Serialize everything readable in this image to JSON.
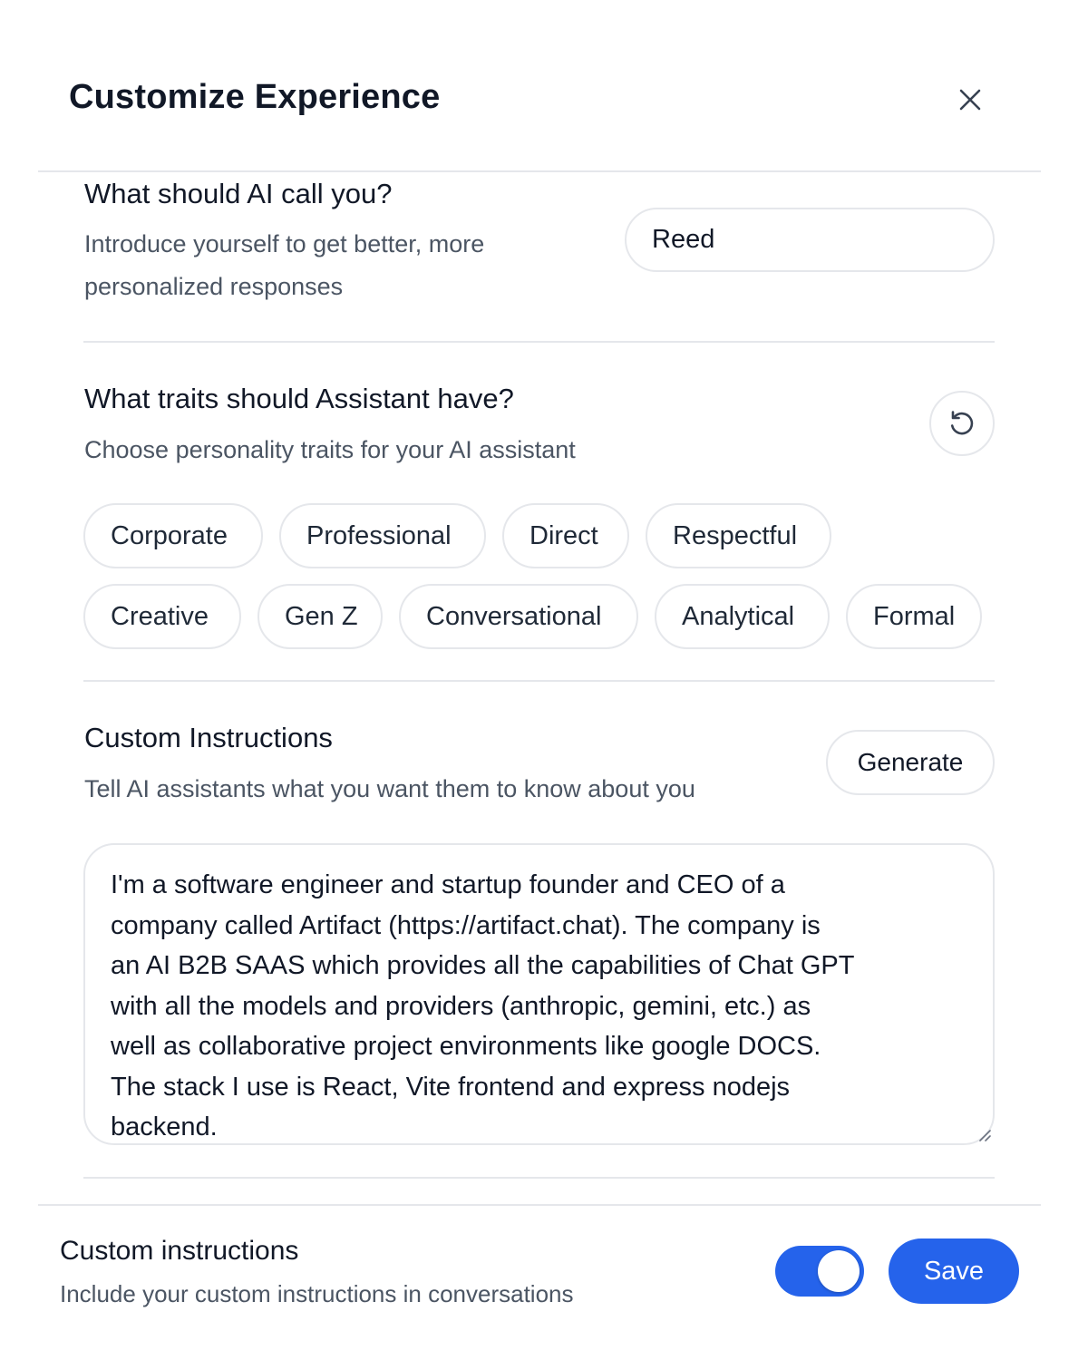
{
  "dialog": {
    "title": "Customize Experience",
    "close_icon": "close-icon"
  },
  "name_section": {
    "title": "What should AI call you?",
    "description_line1": "Introduce yourself to get better, more",
    "description_line2": "personalized responses",
    "input_value": "Reed"
  },
  "traits_section": {
    "title": "What traits should Assistant have?",
    "description": "Choose personality traits for your AI assistant",
    "reset_icon": "reset-icon",
    "row1": [
      "Corporate",
      "Professional",
      "Direct",
      "Respectful"
    ],
    "row2": [
      "Creative",
      "Gen Z",
      "Conversational",
      "Analytical",
      "Formal"
    ]
  },
  "instructions_section": {
    "title": "Custom Instructions",
    "description": "Tell AI assistants what you want them to know about you",
    "generate_label": "Generate",
    "lines": [
      "I'm a software engineer and startup founder and CEO of a",
      "company called Artifact (https://artifact.chat). The company is",
      "an AI B2B SAAS which provides all the capabilities of Chat GPT",
      "with all the models and providers (anthropic, gemini, etc.) as",
      "well as collaborative project environments like google DOCS.",
      "The stack I use is React, Vite frontend and express nodejs",
      "backend."
    ]
  },
  "footer": {
    "title": "Custom instructions",
    "description": "Include your custom instructions in conversations",
    "toggle_on": true,
    "save_label": "Save"
  },
  "colors": {
    "accent": "#2563eb",
    "border": "#e5e7eb",
    "muted_text": "#4b5563"
  }
}
